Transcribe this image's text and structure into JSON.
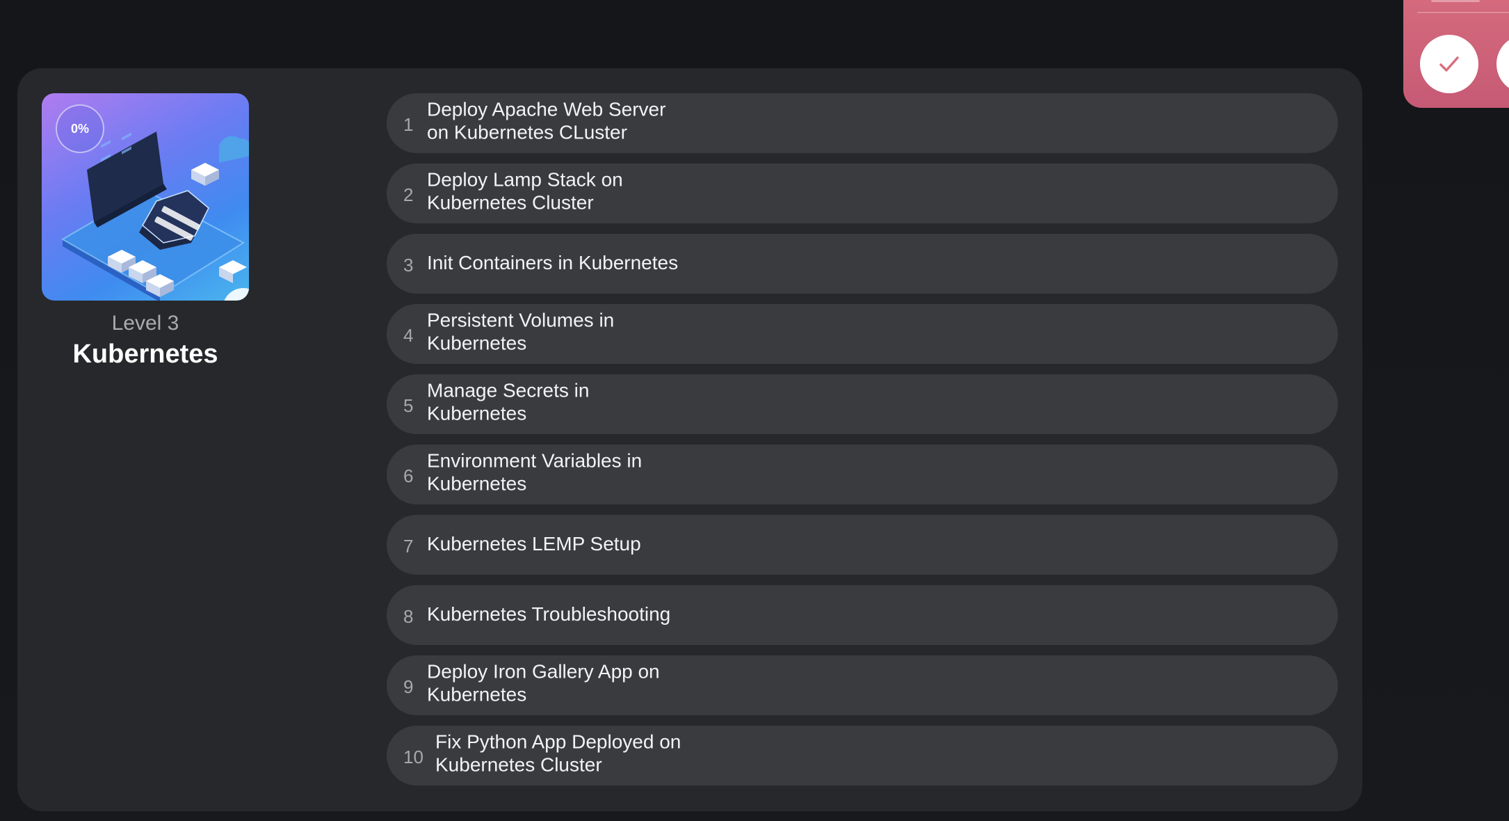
{
  "course": {
    "progress_text": "0%",
    "progress_value": 0,
    "level": "Level 3",
    "title": "Kubernetes",
    "image_icon": "kubernetes-isometric-illustration"
  },
  "lessons": [
    {
      "number": "1",
      "title": "Deploy Apache Web Server on Kubernetes CLuster"
    },
    {
      "number": "2",
      "title": "Deploy Lamp Stack on Kubernetes Cluster"
    },
    {
      "number": "3",
      "title": "Init Containers in Kubernetes"
    },
    {
      "number": "4",
      "title": "Persistent Volumes in Kubernetes"
    },
    {
      "number": "5",
      "title": "Manage Secrets in Kubernetes"
    },
    {
      "number": "6",
      "title": "Environment Variables in Kubernetes"
    },
    {
      "number": "7",
      "title": "Kubernetes LEMP Setup"
    },
    {
      "number": "8",
      "title": "Kubernetes Troubleshooting"
    },
    {
      "number": "9",
      "title": "Deploy Iron Gallery App on Kubernetes"
    },
    {
      "number": "10",
      "title": "Fix Python App Deployed on Kubernetes Cluster"
    }
  ],
  "side_widget": {
    "check_icon": "check-icon",
    "accent_color": "#cf6479"
  },
  "colors": {
    "background": "#16181c",
    "panel": "#27282c",
    "lesson_row": "#3a3b3f",
    "accent": "#cf6479"
  }
}
